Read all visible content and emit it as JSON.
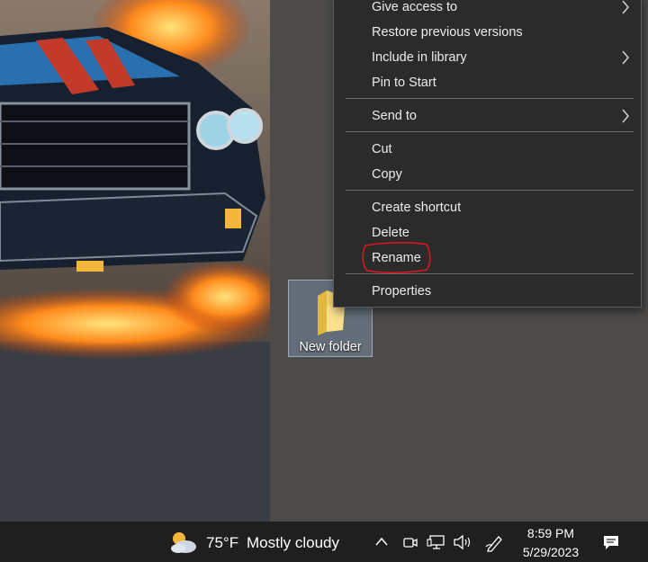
{
  "wallpaper": {
    "description_icon": "car-wallpaper"
  },
  "desktop": {
    "folder": {
      "label": "New folder",
      "icon": "folder-icon"
    }
  },
  "context_menu": {
    "items": [
      {
        "label": "Give access to",
        "submenu": true
      },
      {
        "label": "Restore previous versions",
        "submenu": false
      },
      {
        "label": "Include in library",
        "submenu": true
      },
      {
        "label": "Pin to Start",
        "submenu": false
      },
      {
        "label": "Send to",
        "submenu": true
      },
      {
        "label": "Cut",
        "submenu": false
      },
      {
        "label": "Copy",
        "submenu": false
      },
      {
        "label": "Create shortcut",
        "submenu": false
      },
      {
        "label": "Delete",
        "submenu": false
      },
      {
        "label": "Rename",
        "submenu": false,
        "highlighted_annotation": true
      },
      {
        "label": "Properties",
        "submenu": false
      }
    ]
  },
  "taskbar": {
    "weather": {
      "temp": "75°F",
      "condition": "Mostly cloudy",
      "icon": "partly-cloudy-icon"
    },
    "tray_icons": [
      "chevron-up-icon",
      "meet-now-icon",
      "network-icon",
      "volume-icon",
      "pen-icon"
    ],
    "clock": {
      "time": "8:59 PM",
      "date": "5/29/2023"
    },
    "notification_icon": "notification-icon"
  },
  "colors": {
    "menu_bg": "#2b2b2b",
    "menu_text": "#ececec",
    "taskbar_bg": "#1f1f1f",
    "desktop_bg": "#4d4b49",
    "annotation": "#e0141e"
  }
}
